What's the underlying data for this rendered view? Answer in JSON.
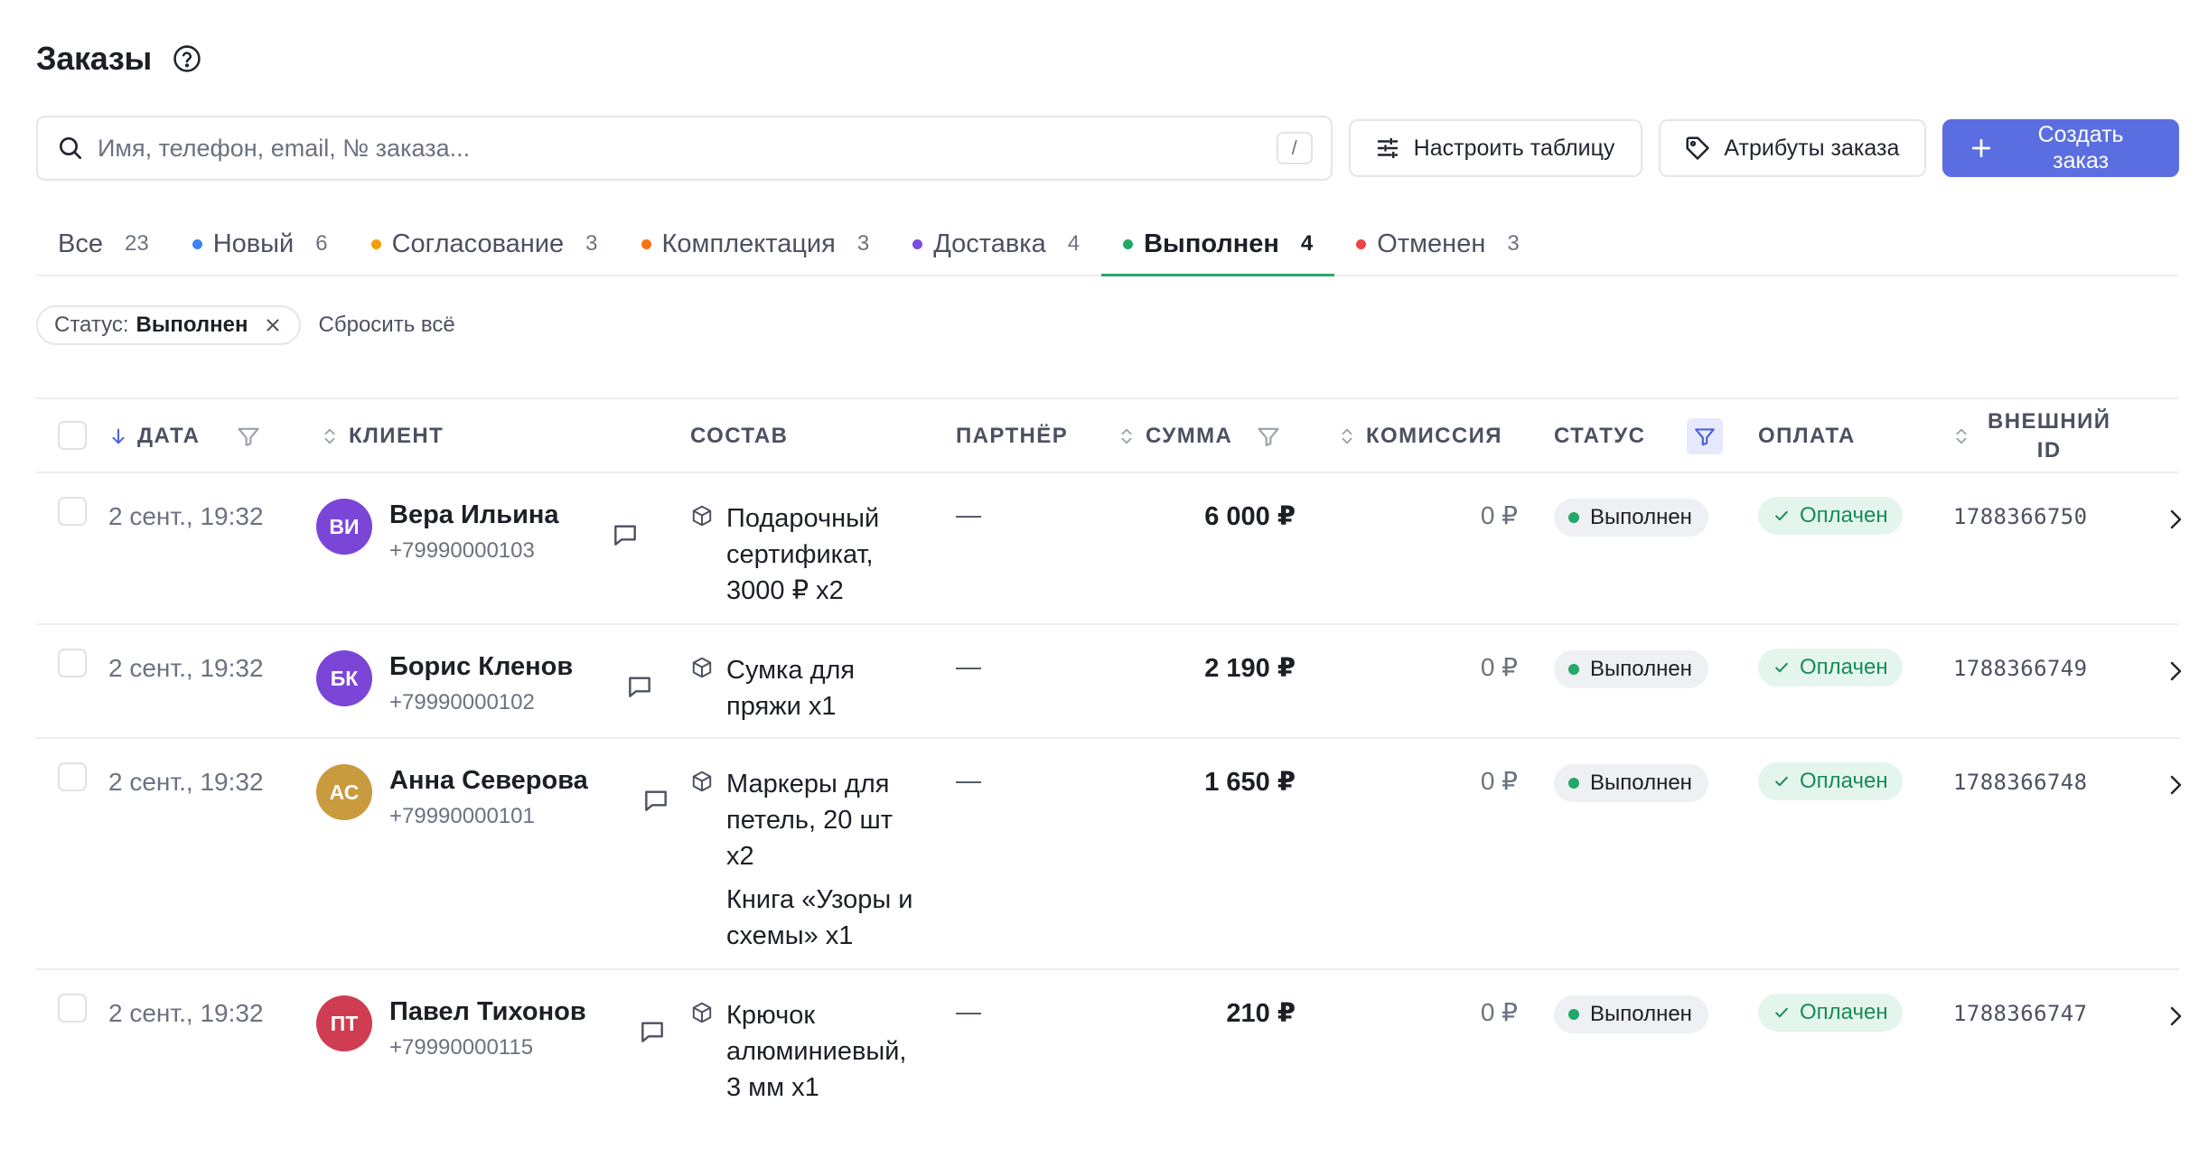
{
  "header": {
    "title": "Заказы"
  },
  "search": {
    "placeholder": "Имя, телефон, email, № заказа...",
    "shortcut": "/"
  },
  "toolbar": {
    "configure_label": "Настроить таблицу",
    "attributes_label": "Атрибуты заказа",
    "create_label": "Создать заказ"
  },
  "tabs": [
    {
      "label": "Все",
      "count": "23",
      "color": ""
    },
    {
      "label": "Новый",
      "count": "6",
      "color": "#3b82f6"
    },
    {
      "label": "Согласование",
      "count": "3",
      "color": "#f59e0b"
    },
    {
      "label": "Комплектация",
      "count": "3",
      "color": "#f97316"
    },
    {
      "label": "Доставка",
      "count": "4",
      "color": "#7c4dde"
    },
    {
      "label": "Выполнен",
      "count": "4",
      "color": "#22a86a",
      "active": true
    },
    {
      "label": "Отменен",
      "count": "3",
      "color": "#ef4444"
    }
  ],
  "filters": {
    "chip_label": "Статус:",
    "chip_value": "Выполнен",
    "reset_label": "Сбросить всё"
  },
  "columns": {
    "date": "Дата",
    "client": "Клиент",
    "items": "Состав",
    "partner": "Партнёр",
    "amount": "Сумма",
    "commission": "Комиссия",
    "status": "Статус",
    "payment": "Оплата",
    "external_id_1": "Внешний",
    "external_id_2": "ID"
  },
  "rows": [
    {
      "date": "2 сент., 19:32",
      "initials": "ВИ",
      "avatar_color": "#7b45d8",
      "name": "Вера Ильина",
      "phone": "+79990000103",
      "items": [
        "Подарочный сертификат, 3000 ₽ x2"
      ],
      "partner": "—",
      "amount": "6 000 ₽",
      "commission": "0 ₽",
      "status": "Выполнен",
      "payment": "Оплачен",
      "external_id": "1788366750"
    },
    {
      "date": "2 сент., 19:32",
      "initials": "БК",
      "avatar_color": "#7b45d8",
      "name": "Борис Кленов",
      "phone": "+79990000102",
      "items": [
        "Сумка для пряжи x1"
      ],
      "partner": "—",
      "amount": "2 190 ₽",
      "commission": "0 ₽",
      "status": "Выполнен",
      "payment": "Оплачен",
      "external_id": "1788366749"
    },
    {
      "date": "2 сент., 19:32",
      "initials": "АС",
      "avatar_color": "#c99a3e",
      "name": "Анна Северова",
      "phone": "+79990000101",
      "items": [
        "Маркеры для петель, 20 шт x2",
        "Книга «Узоры и схемы» x1"
      ],
      "partner": "—",
      "amount": "1 650 ₽",
      "commission": "0 ₽",
      "status": "Выполнен",
      "payment": "Оплачен",
      "external_id": "1788366748"
    },
    {
      "date": "2 сент., 19:32",
      "initials": "ПТ",
      "avatar_color": "#cf3d52",
      "name": "Павел Тихонов",
      "phone": "+79990000115",
      "items": [
        "Крючок алюминиевый, 3 мм x1"
      ],
      "partner": "—",
      "amount": "210 ₽",
      "commission": "0 ₽",
      "status": "Выполнен",
      "payment": "Оплачен",
      "external_id": "1788366747"
    }
  ]
}
